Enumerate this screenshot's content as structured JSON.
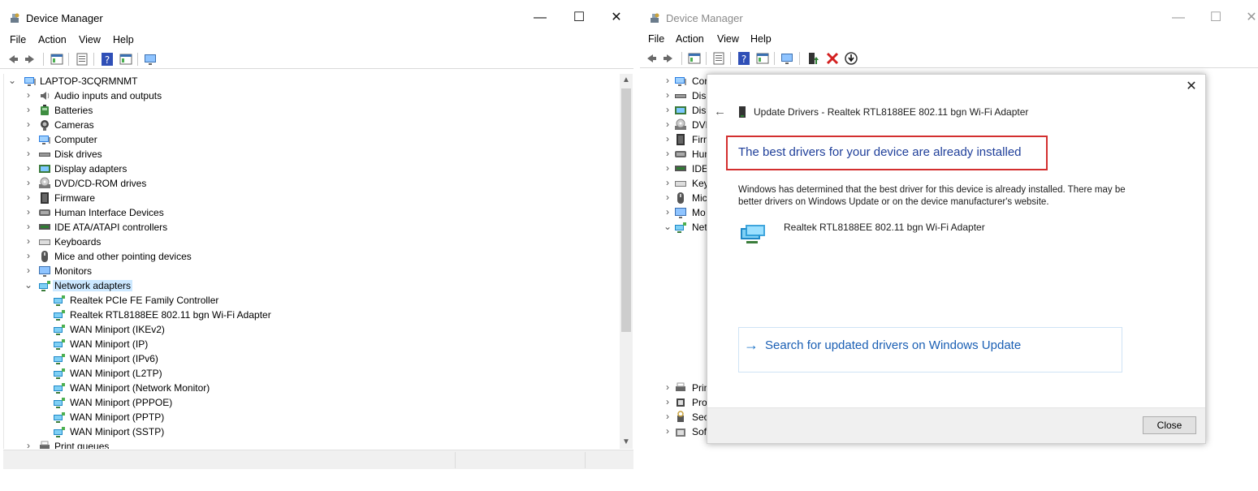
{
  "left_window": {
    "title": "Device Manager",
    "controls": {
      "minimize": "—",
      "maximize": "☐",
      "close": "✕"
    },
    "menu": [
      "File",
      "Action",
      "View",
      "Help"
    ],
    "tree": {
      "root": "LAPTOP-3CQRMNMT",
      "categories": [
        "Audio inputs and outputs",
        "Batteries",
        "Cameras",
        "Computer",
        "Disk drives",
        "Display adapters",
        "DVD/CD-ROM drives",
        "Firmware",
        "Human Interface Devices",
        "IDE ATA/ATAPI controllers",
        "Keyboards",
        "Mice and other pointing devices",
        "Monitors",
        "Network adapters"
      ],
      "network_children": [
        "Realtek PCIe FE Family Controller",
        "Realtek RTL8188EE 802.11 bgn Wi-Fi Adapter",
        "WAN Miniport (IKEv2)",
        "WAN Miniport (IP)",
        "WAN Miniport (IPv6)",
        "WAN Miniport (L2TP)",
        "WAN Miniport (Network Monitor)",
        "WAN Miniport (PPPOE)",
        "WAN Miniport (PPTP)",
        "WAN Miniport (SSTP)"
      ],
      "after": "Print queues"
    }
  },
  "right_window": {
    "title": "Device Manager",
    "controls": {
      "minimize": "—",
      "maximize": "☐",
      "close": "✕"
    },
    "menu": [
      "File",
      "Action",
      "View",
      "Help"
    ],
    "tree_partial_top": [
      "Cor",
      "Disk",
      "Disp",
      "DVD",
      "Firm",
      "Hum",
      "IDE",
      "Key",
      "Mic",
      "Mo",
      "Net"
    ],
    "tree_partial_bottom": [
      "Prin",
      "Pro",
      "Sec",
      "Sof"
    ]
  },
  "dialog": {
    "close": "✕",
    "back": "←",
    "title": "Update Drivers - Realtek RTL8188EE 802.11 bgn Wi-Fi Adapter",
    "heading": "The best drivers for your device are already installed",
    "description": "Windows has determined that the best driver for this device is already installed. There may be better drivers on Windows Update or on the device manufacturer's website.",
    "device_name": "Realtek RTL8188EE 802.11 bgn Wi-Fi Adapter",
    "link_arrow": "→",
    "link_text": "Search for updated drivers on Windows Update",
    "close_button": "Close",
    "highlight_color": "#d32f2f"
  }
}
